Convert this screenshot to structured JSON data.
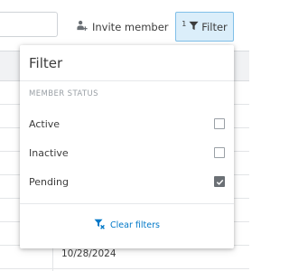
{
  "toolbar": {
    "invite_label": "Invite member",
    "filter_label": "Filter",
    "filter_count": "1"
  },
  "table": {
    "visible_date": "10/28/2024"
  },
  "filter_panel": {
    "title": "Filter",
    "section_label": "MEMBER STATUS",
    "options": [
      {
        "label": "Active",
        "checked": false
      },
      {
        "label": "Inactive",
        "checked": false
      },
      {
        "label": "Pending",
        "checked": true
      }
    ],
    "clear_label": "Clear filters"
  },
  "colors": {
    "accent": "#0078c8",
    "filter_active_bg": "#dbeefa",
    "checked_box": "#6b7075"
  }
}
